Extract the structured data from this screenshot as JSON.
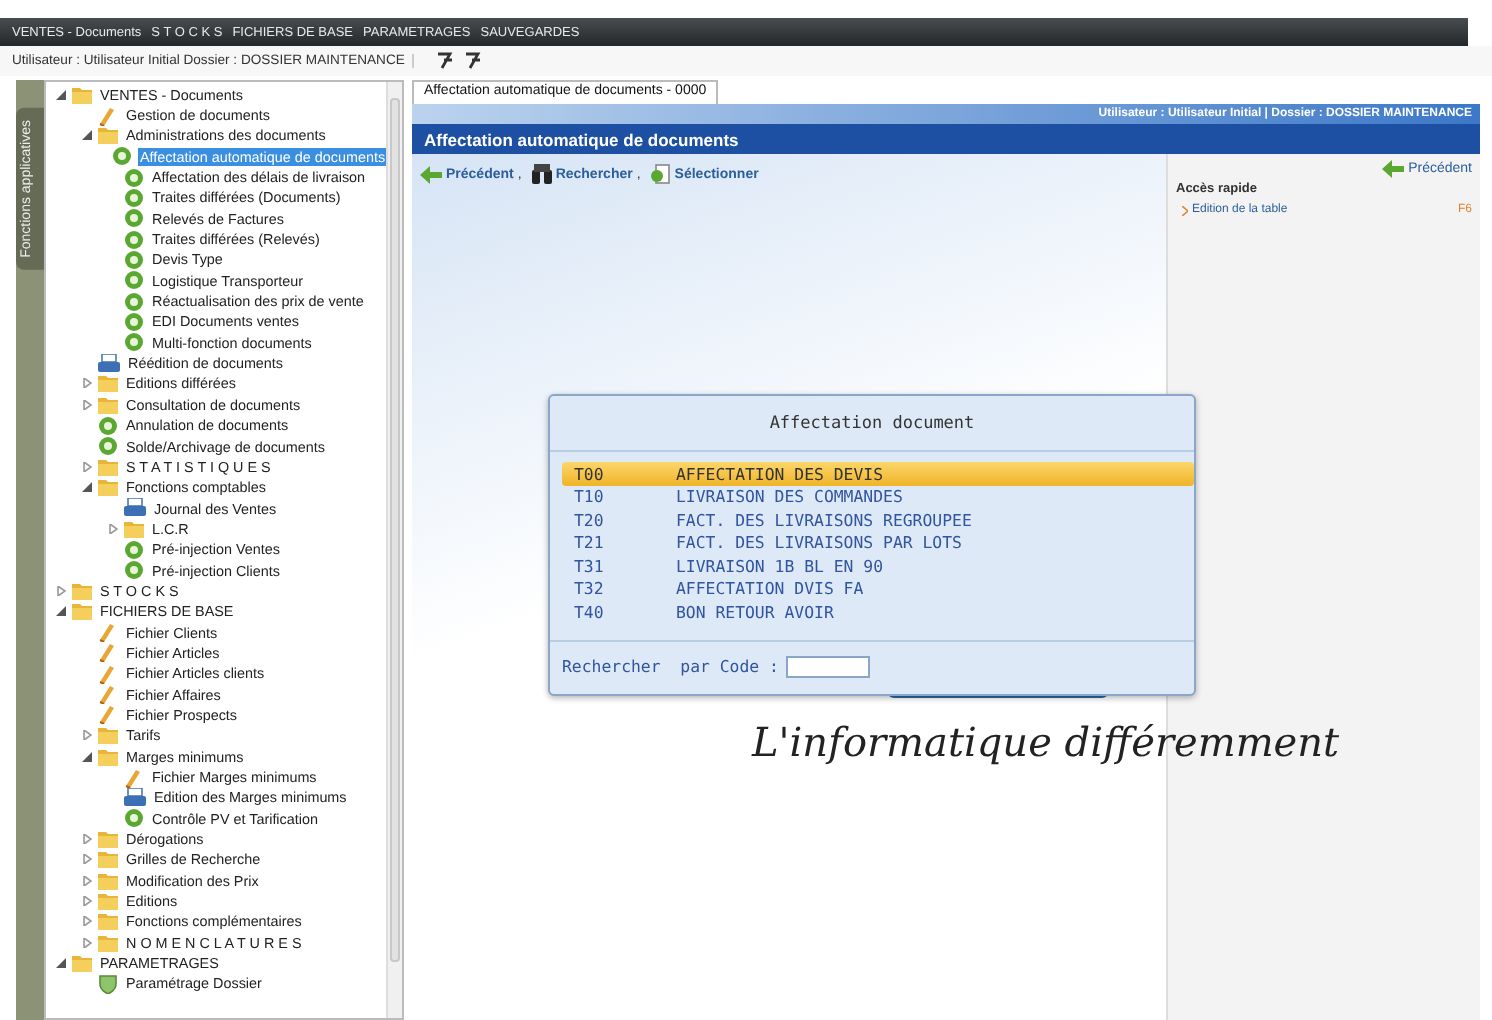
{
  "menu_bar": {
    "items": [
      {
        "label": "VENTES - Documents",
        "selected": false
      },
      {
        "label": "S T O C K S",
        "selected": false
      },
      {
        "label": "FICHIERS DE BASE",
        "selected": false
      },
      {
        "label": "PARAMETRAGES",
        "selected": false
      },
      {
        "label": "SAUVEGARDES",
        "selected": false
      }
    ]
  },
  "user_bar": {
    "text": "Utilisateur : Utilisateur Initial  Dossier : DOSSIER MAINTENANCE"
  },
  "side_tab": {
    "label": "Fonctions applicatives"
  },
  "tree": [
    {
      "label": "VENTES - Documents",
      "kind": "folder",
      "expanded": true,
      "selected": false,
      "children": [
        {
          "label": "Gestion de documents",
          "kind": "form",
          "selected": false
        },
        {
          "label": "Administrations des documents",
          "kind": "folder",
          "expanded": true,
          "selected": false,
          "children": [
            {
              "label": "Affectation automatique de documents",
              "kind": "action",
              "selected": true
            },
            {
              "label": "Affectation des délais de livraison",
              "kind": "action",
              "selected": false
            },
            {
              "label": "Traites différées (Documents)",
              "kind": "action",
              "selected": false
            },
            {
              "label": "Relevés de Factures",
              "kind": "action",
              "selected": false
            },
            {
              "label": "Traites différées (Relevés)",
              "kind": "action",
              "selected": false
            },
            {
              "label": "Devis Type",
              "kind": "action",
              "selected": false
            },
            {
              "label": "Logistique Transporteur",
              "kind": "action",
              "selected": false
            },
            {
              "label": "Réactualisation des prix de vente",
              "kind": "action",
              "selected": false
            },
            {
              "label": "EDI Documents ventes",
              "kind": "action",
              "selected": false
            },
            {
              "label": "Multi-fonction documents",
              "kind": "action",
              "selected": false
            }
          ]
        },
        {
          "label": "Réédition de documents",
          "kind": "print",
          "selected": false
        },
        {
          "label": "Editions différées",
          "kind": "folder",
          "expanded": false,
          "selected": false
        },
        {
          "label": "Consultation de documents",
          "kind": "folder",
          "expanded": false,
          "selected": false
        },
        {
          "label": "Annulation de documents",
          "kind": "action",
          "selected": false
        },
        {
          "label": "Solde/Archivage de documents",
          "kind": "action",
          "selected": false
        },
        {
          "label": "S T A T I S T I Q U E S",
          "kind": "folder",
          "expanded": false,
          "selected": false
        },
        {
          "label": "Fonctions comptables",
          "kind": "folder",
          "expanded": true,
          "selected": false,
          "children": [
            {
              "label": "Journal des Ventes",
              "kind": "print",
              "selected": false
            },
            {
              "label": "L.C.R",
              "kind": "folder",
              "expanded": false,
              "selected": false
            },
            {
              "label": "Pré-injection Ventes",
              "kind": "action",
              "selected": false
            },
            {
              "label": "Pré-injection Clients",
              "kind": "action",
              "selected": false
            }
          ]
        }
      ]
    },
    {
      "label": "S T O C K S",
      "kind": "folder",
      "expanded": false,
      "selected": false
    },
    {
      "label": "FICHIERS DE BASE",
      "kind": "folder",
      "expanded": true,
      "selected": false,
      "children": [
        {
          "label": "Fichier Clients",
          "kind": "form",
          "selected": false
        },
        {
          "label": "Fichier Articles",
          "kind": "form",
          "selected": false
        },
        {
          "label": "Fichier Articles clients",
          "kind": "form",
          "selected": false
        },
        {
          "label": "Fichier Affaires",
          "kind": "form",
          "selected": false
        },
        {
          "label": "Fichier Prospects",
          "kind": "form",
          "selected": false
        },
        {
          "label": "Tarifs",
          "kind": "folder",
          "expanded": false,
          "selected": false
        },
        {
          "label": "Marges minimums",
          "kind": "folder",
          "expanded": true,
          "selected": false,
          "children": [
            {
              "label": "Fichier Marges minimums",
              "kind": "form",
              "selected": false
            },
            {
              "label": "Edition des Marges minimums",
              "kind": "print",
              "selected": false
            },
            {
              "label": "Contrôle PV et Tarification",
              "kind": "action",
              "selected": false
            }
          ]
        },
        {
          "label": "Dérogations",
          "kind": "folder",
          "expanded": false,
          "selected": false
        },
        {
          "label": "Grilles de Recherche",
          "kind": "folder",
          "expanded": false,
          "selected": false
        },
        {
          "label": "Modification des Prix",
          "kind": "folder",
          "expanded": false,
          "selected": false
        },
        {
          "label": "Editions",
          "kind": "folder",
          "expanded": false,
          "selected": false
        },
        {
          "label": "Fonctions complémentaires",
          "kind": "folder",
          "expanded": false,
          "selected": false
        },
        {
          "label": "N O M E N C L A T U R E S",
          "kind": "folder",
          "expanded": false,
          "selected": false
        }
      ]
    },
    {
      "label": "PARAMETRAGES",
      "kind": "folder",
      "expanded": true,
      "selected": false,
      "children": [
        {
          "label": "Paramétrage Dossier",
          "kind": "settings",
          "selected": false
        }
      ]
    }
  ],
  "tabs": [
    {
      "label": "Affectation automatique de documents - 0000",
      "selected": true
    }
  ],
  "header": {
    "user_info": "Utilisateur : Utilisateur Initial | Dossier : DOSSIER MAINTENANCE",
    "title": "Affectation automatique de documents"
  },
  "toolbar": [
    {
      "label": "Précédent",
      "kind": "back",
      "separator": ","
    },
    {
      "label": "Rechercher",
      "kind": "search",
      "separator": ","
    },
    {
      "label": "Sélectionner",
      "kind": "select"
    }
  ],
  "quick_panel": {
    "back": "Précédent",
    "title": "Accès rapide",
    "links": [
      {
        "label": "Edition de la table",
        "shortcut": "F6"
      }
    ]
  },
  "logo": {
    "tagline": "L'informatique différemment"
  },
  "dialog": {
    "title": "Affectation document",
    "items": [
      {
        "code": "T00",
        "label": "AFFECTATION DES DEVIS",
        "selected": true
      },
      {
        "code": "T10",
        "label": "LIVRAISON DES COMMANDES",
        "selected": false
      },
      {
        "code": "T20",
        "label": "FACT. DES LIVRAISONS REGROUPEE",
        "selected": false
      },
      {
        "code": "T21",
        "label": "FACT. DES LIVRAISONS PAR LOTS",
        "selected": false
      },
      {
        "code": "T31",
        "label": "LIVRAISON 1B BL EN 90",
        "selected": false
      },
      {
        "code": "T32",
        "label": "AFFECTATION DVIS FA",
        "selected": false
      },
      {
        "code": "T40",
        "label": "BON RETOUR AVOIR",
        "selected": false
      }
    ],
    "search_label": "Rechercher  par Code :"
  }
}
